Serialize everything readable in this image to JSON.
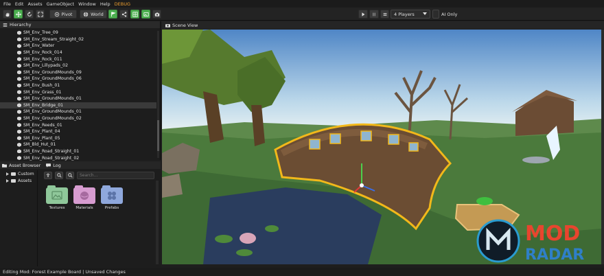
{
  "menu": [
    "File",
    "Edit",
    "Assets",
    "GameObject",
    "Window",
    "Help"
  ],
  "menu_debug": "DEBUG",
  "toolbar": {
    "pivot_label": "Pivot",
    "world_label": "World",
    "players_select": "4 Players",
    "ai_only_label": "AI Only"
  },
  "hierarchy": {
    "title": "Hierarchy",
    "items": [
      "SM_Env_Tree_09",
      "SM_Env_Stream_Straight_02",
      "SM_Env_Water",
      "SM_Env_Rock_014",
      "SM_Env_Rock_011",
      "SM_Env_Lillypads_02",
      "SM_Env_GroundMounds_09",
      "SM_Env_GroundMounds_06",
      "SM_Env_Bush_01",
      "SM_Env_Grass_01",
      "SM_Env_GroundMounds_01",
      "SM_Env_Bridge_01",
      "SM_Env_GroundMounds_01",
      "SM_Env_GroundMounds_02",
      "SM_Env_Reeds_01",
      "SM_Env_Plant_04",
      "SM_Env_Plant_05",
      "SM_Bld_Hut_01",
      "SM_Env_Road_Straight_01",
      "SM_Env_Road_Straight_02"
    ],
    "selected_index": 11
  },
  "asset_panel": {
    "tab_asset_browser": "Asset Browser",
    "tab_log": "Log",
    "tree": [
      "Custom",
      "Assets"
    ],
    "search_placeholder": "Search...",
    "folders": [
      {
        "label": "Textures",
        "color": "#8fc79a"
      },
      {
        "label": "Materials",
        "color": "#d79cd0"
      },
      {
        "label": "Prefabs",
        "color": "#8fa8dc"
      }
    ]
  },
  "scene": {
    "title": "Scene View"
  },
  "watermark": {
    "line1": "MOD",
    "line2": "RADAR"
  },
  "status": "Editing Mod: Forest Example Board | Unsaved Changes"
}
